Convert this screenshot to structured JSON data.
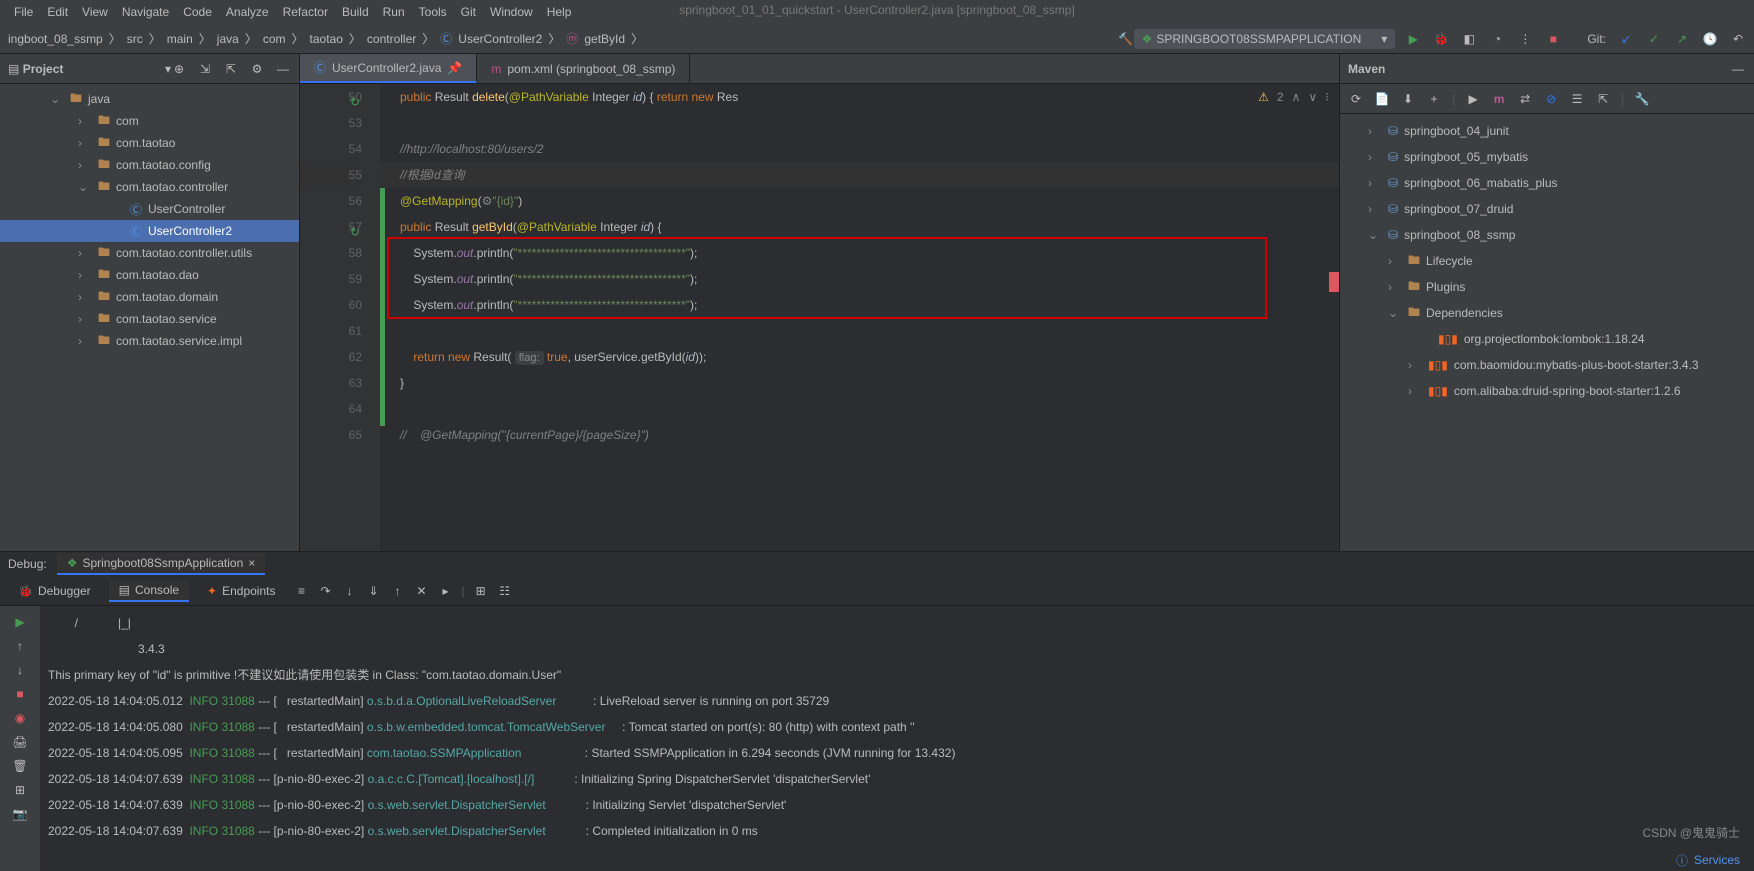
{
  "window": {
    "title": "springboot_01_01_quickstart - UserController2.java [springboot_08_ssmp]"
  },
  "menu": {
    "file": "File",
    "edit": "Edit",
    "view": "View",
    "navigate": "Navigate",
    "code": "Code",
    "analyze": "Analyze",
    "refactor": "Refactor",
    "build": "Build",
    "run": "Run",
    "tools": "Tools",
    "git": "Git",
    "window": "Window",
    "help": "Help"
  },
  "breadcrumbs": {
    "root": "ingboot_08_ssmp",
    "src": "src",
    "main": "main",
    "java": "java",
    "com": "com",
    "taotao": "taotao",
    "controller": "controller",
    "class": "UserController2",
    "method": "getById"
  },
  "runconfig": {
    "name": "SPRINGBOOT08SSMPAPPLICATION"
  },
  "gitlabel": "Git:",
  "project": {
    "title": "Project",
    "items": [
      {
        "label": "java",
        "indent": 50,
        "open": true,
        "kind": "folder"
      },
      {
        "label": "com",
        "indent": 78,
        "open": false,
        "kind": "folder",
        "ch": "›"
      },
      {
        "label": "com.taotao",
        "indent": 78,
        "open": false,
        "kind": "folder",
        "ch": "›"
      },
      {
        "label": "com.taotao.config",
        "indent": 78,
        "open": false,
        "kind": "folder",
        "ch": "›"
      },
      {
        "label": "com.taotao.controller",
        "indent": 78,
        "open": true,
        "kind": "folder",
        "ch": "⌄"
      },
      {
        "label": "UserController",
        "indent": 110,
        "kind": "class"
      },
      {
        "label": "UserController2",
        "indent": 110,
        "kind": "class",
        "selected": true
      },
      {
        "label": "com.taotao.controller.utils",
        "indent": 78,
        "open": false,
        "kind": "folder",
        "ch": "›"
      },
      {
        "label": "com.taotao.dao",
        "indent": 78,
        "open": false,
        "kind": "folder",
        "ch": "›"
      },
      {
        "label": "com.taotao.domain",
        "indent": 78,
        "open": false,
        "kind": "folder",
        "ch": "›"
      },
      {
        "label": "com.taotao.service",
        "indent": 78,
        "open": false,
        "kind": "folder",
        "ch": "›"
      },
      {
        "label": "com.taotao.service.impl",
        "indent": 78,
        "open": false,
        "kind": "folder",
        "ch": "›"
      }
    ]
  },
  "tabs": {
    "t1": "UserController2.java",
    "t2": "pom.xml (springboot_08_ssmp)"
  },
  "code": {
    "lines": [
      "50",
      "53",
      "54",
      "55",
      "56",
      "57",
      "58",
      "59",
      "60",
      "61",
      "62",
      "63",
      "64",
      "65"
    ],
    "l50": "            public Result delete(@PathVariable Integer id) { return new Res",
    "l54": "            //http://localhost:80/users/2",
    "l55": "            //根据Id查询",
    "l56": "            @GetMapping(⚙\"{id}\")",
    "l57": "            public Result getById(@PathVariable Integer id) {",
    "l58": "                System.out.println(\"************************************\");",
    "l59": "                System.out.println(\"************************************\");",
    "l60": "                System.out.println(\"************************************\");",
    "l62": "                return new Result( flag: true, userService.getById(id));",
    "l63": "            }",
    "l65": "//    @GetMapping(\"{currentPage}/{pageSize}\")",
    "inspect_warn": "2",
    "hint_flag": "flag:"
  },
  "maven": {
    "title": "Maven",
    "items": [
      {
        "label": "springboot_04_junit",
        "indent": 28,
        "ch": "›",
        "kind": "module"
      },
      {
        "label": "springboot_05_mybatis",
        "indent": 28,
        "ch": "›",
        "kind": "module"
      },
      {
        "label": "springboot_06_mabatis_plus",
        "indent": 28,
        "ch": "›",
        "kind": "module"
      },
      {
        "label": "springboot_07_druid",
        "indent": 28,
        "ch": "›",
        "kind": "module"
      },
      {
        "label": "springboot_08_ssmp",
        "indent": 28,
        "ch": "⌄",
        "kind": "module"
      },
      {
        "label": "Lifecycle",
        "indent": 48,
        "ch": "›",
        "kind": "folder"
      },
      {
        "label": "Plugins",
        "indent": 48,
        "ch": "›",
        "kind": "folder"
      },
      {
        "label": "Dependencies",
        "indent": 48,
        "ch": "⌄",
        "kind": "folder"
      },
      {
        "label": "org.projectlombok:lombok:1.18.24",
        "indent": 78,
        "kind": "lib"
      },
      {
        "label": "com.baomidou:mybatis-plus-boot-starter:3.4.3",
        "indent": 68,
        "ch": "›",
        "kind": "lib"
      },
      {
        "label": "com.alibaba:druid-spring-boot-starter:1.2.6",
        "indent": 68,
        "ch": "›",
        "kind": "lib"
      }
    ]
  },
  "debug": {
    "label": "Debug:",
    "app": "Springboot08SsmpApplication",
    "tabs": {
      "debugger": "Debugger",
      "console": "Console",
      "endpoints": "Endpoints"
    }
  },
  "console": {
    "slash": "        /            |_|",
    "version": "                           3.4.3",
    "warn": "This primary key of \"id\" is primitive !不建议如此请使用包装类 in Class: \"com.taotao.domain.User\"",
    "log1": {
      "ts": "2022-05-18 14:04:05.012",
      "lvl": "INFO",
      "pid": "31088",
      "thr": "[   restartedMain]",
      "cls": "o.s.b.d.a.OptionalLiveReloadServer",
      "msg": ": LiveReload server is running on port 35729"
    },
    "log2": {
      "ts": "2022-05-18 14:04:05.080",
      "lvl": "INFO",
      "pid": "31088",
      "thr": "[   restartedMain]",
      "cls": "o.s.b.w.embedded.tomcat.TomcatWebServer",
      "msg": ": Tomcat started on port(s): 80 (http) with context path ''"
    },
    "log3": {
      "ts": "2022-05-18 14:04:05.095",
      "lvl": "INFO",
      "pid": "31088",
      "thr": "[   restartedMain]",
      "cls": "com.taotao.SSMPApplication",
      "msg": ": Started SSMPApplication in 6.294 seconds (JVM running for 13.432)"
    },
    "log4": {
      "ts": "2022-05-18 14:04:07.639",
      "lvl": "INFO",
      "pid": "31088",
      "thr": "[p-nio-80-exec-2]",
      "cls": "o.a.c.c.C.[Tomcat].[localhost].[/]",
      "msg": ": Initializing Spring DispatcherServlet 'dispatcherServlet'"
    },
    "log5": {
      "ts": "2022-05-18 14:04:07.639",
      "lvl": "INFO",
      "pid": "31088",
      "thr": "[p-nio-80-exec-2]",
      "cls": "o.s.web.servlet.DispatcherServlet",
      "msg": ": Initializing Servlet 'dispatcherServlet'"
    },
    "log6": {
      "ts": "2022-05-18 14:04:07.639",
      "lvl": "INFO",
      "pid": "31088",
      "thr": "[p-nio-80-exec-2]",
      "cls": "o.s.web.servlet.DispatcherServlet",
      "msg": ": Completed initialization in 0 ms"
    }
  },
  "watermark": "CSDN @鬼鬼骑士",
  "status": {
    "services": "Services"
  }
}
